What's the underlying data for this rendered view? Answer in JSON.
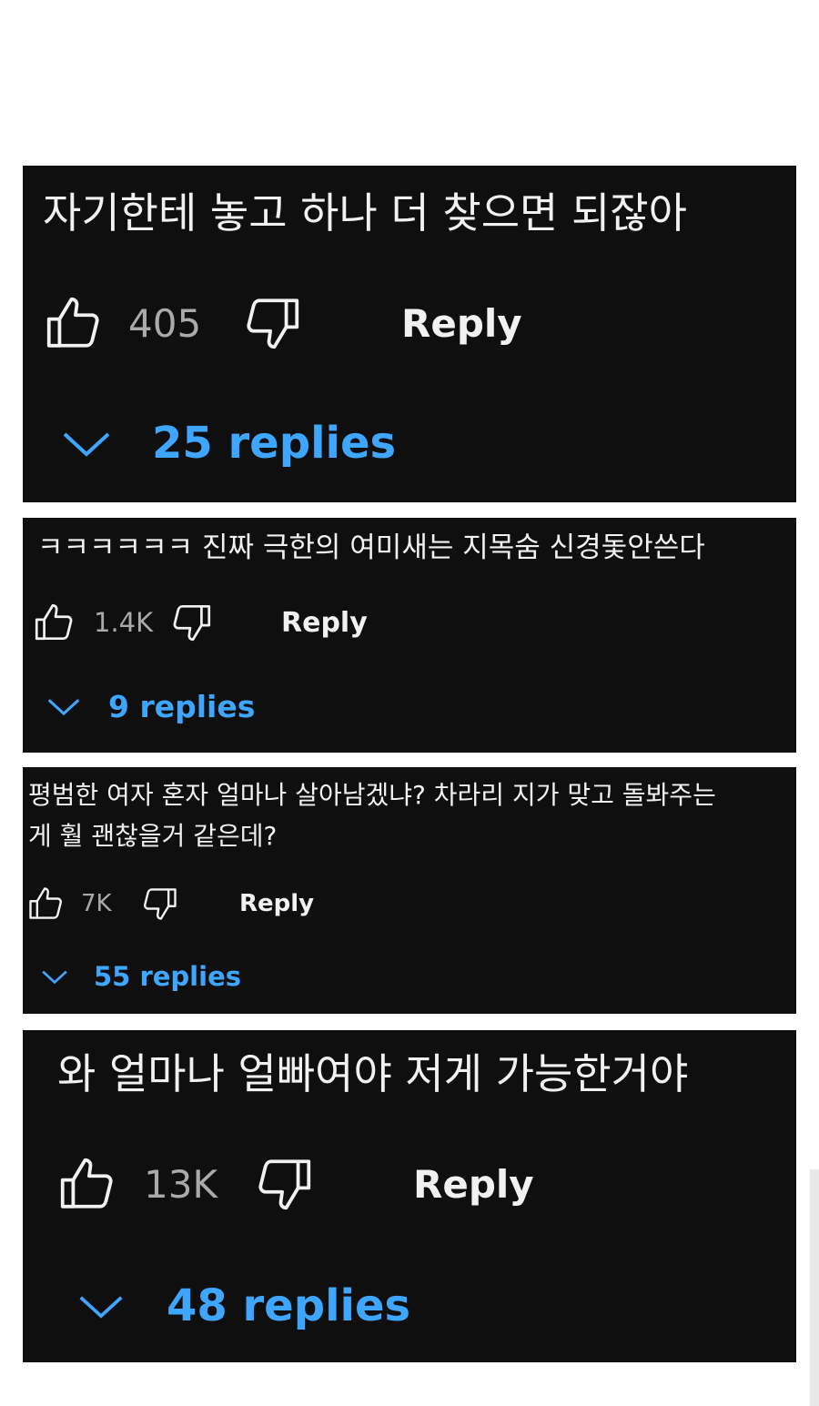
{
  "colors": {
    "card_bg": "#0f0f0f",
    "text": "#f1f1f1",
    "count": "#aaaaaa",
    "link": "#3ea6ff"
  },
  "comments": [
    {
      "text": "자기한테 놓고 하나 더 찾으면 되잖아",
      "likes": "405",
      "reply_label": "Reply",
      "replies_label": "25 replies",
      "icons": [
        "thumbs-up-icon",
        "thumbs-down-icon",
        "chevron-down-icon"
      ]
    },
    {
      "text": "ㅋㅋㅋㅋㅋㅋ 진짜 극한의 여미새는 지목숨 신경돛안쓴다",
      "likes": "1.4K",
      "reply_label": "Reply",
      "replies_label": "9 replies",
      "icons": [
        "thumbs-up-icon",
        "thumbs-down-icon",
        "chevron-down-icon"
      ]
    },
    {
      "text": "평범한 여자 혼자 얼마나 살아남겠냐? 차라리 지가 맞고 돌봐주는\n게 훨 괜찮을거 같은데?",
      "likes": "7K",
      "reply_label": "Reply",
      "replies_label": "55 replies",
      "icons": [
        "thumbs-up-icon",
        "thumbs-down-icon",
        "chevron-down-icon"
      ]
    },
    {
      "text": "와 얼마나 얼빠여야 저게 가능한거야",
      "likes": "13K",
      "reply_label": "Reply",
      "replies_label": "48 replies",
      "icons": [
        "thumbs-up-icon",
        "thumbs-down-icon",
        "chevron-down-icon"
      ]
    }
  ]
}
